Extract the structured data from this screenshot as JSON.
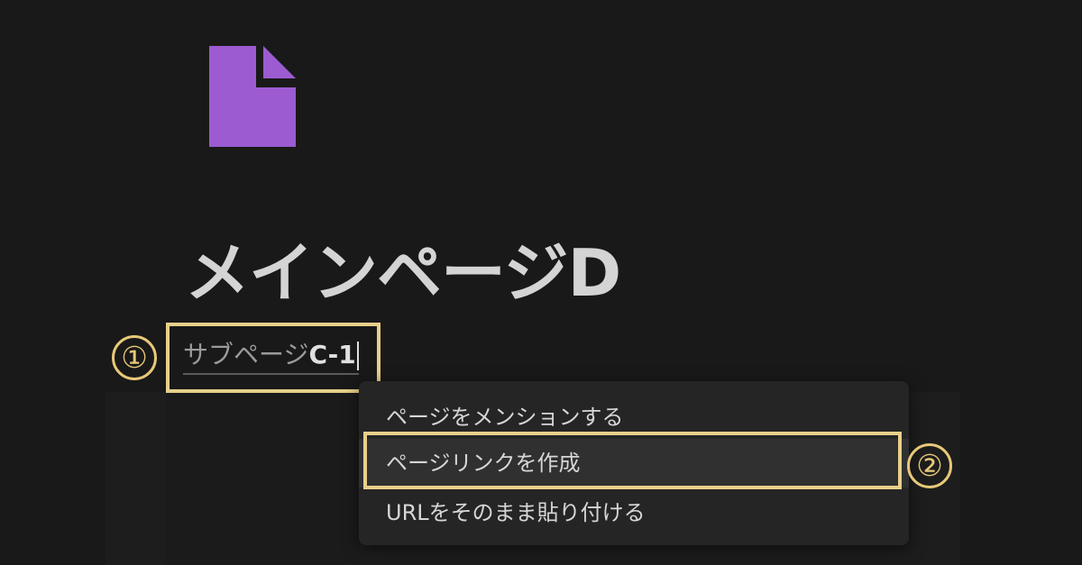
{
  "page": {
    "icon": "document-icon",
    "icon_color": "#9d5bd2",
    "title": "メインページD"
  },
  "link_input": {
    "placeholder_text": "サブページ",
    "typed_text": "C-1"
  },
  "menu": {
    "items": [
      {
        "label": "ページをメンションする",
        "highlighted": false
      },
      {
        "label": "ページリンクを作成",
        "highlighted": true
      },
      {
        "label": "URLをそのまま貼り付ける",
        "highlighted": false
      }
    ]
  },
  "annotations": {
    "step1_label": "①",
    "step2_label": "②",
    "marker_color": "#e8c878"
  }
}
